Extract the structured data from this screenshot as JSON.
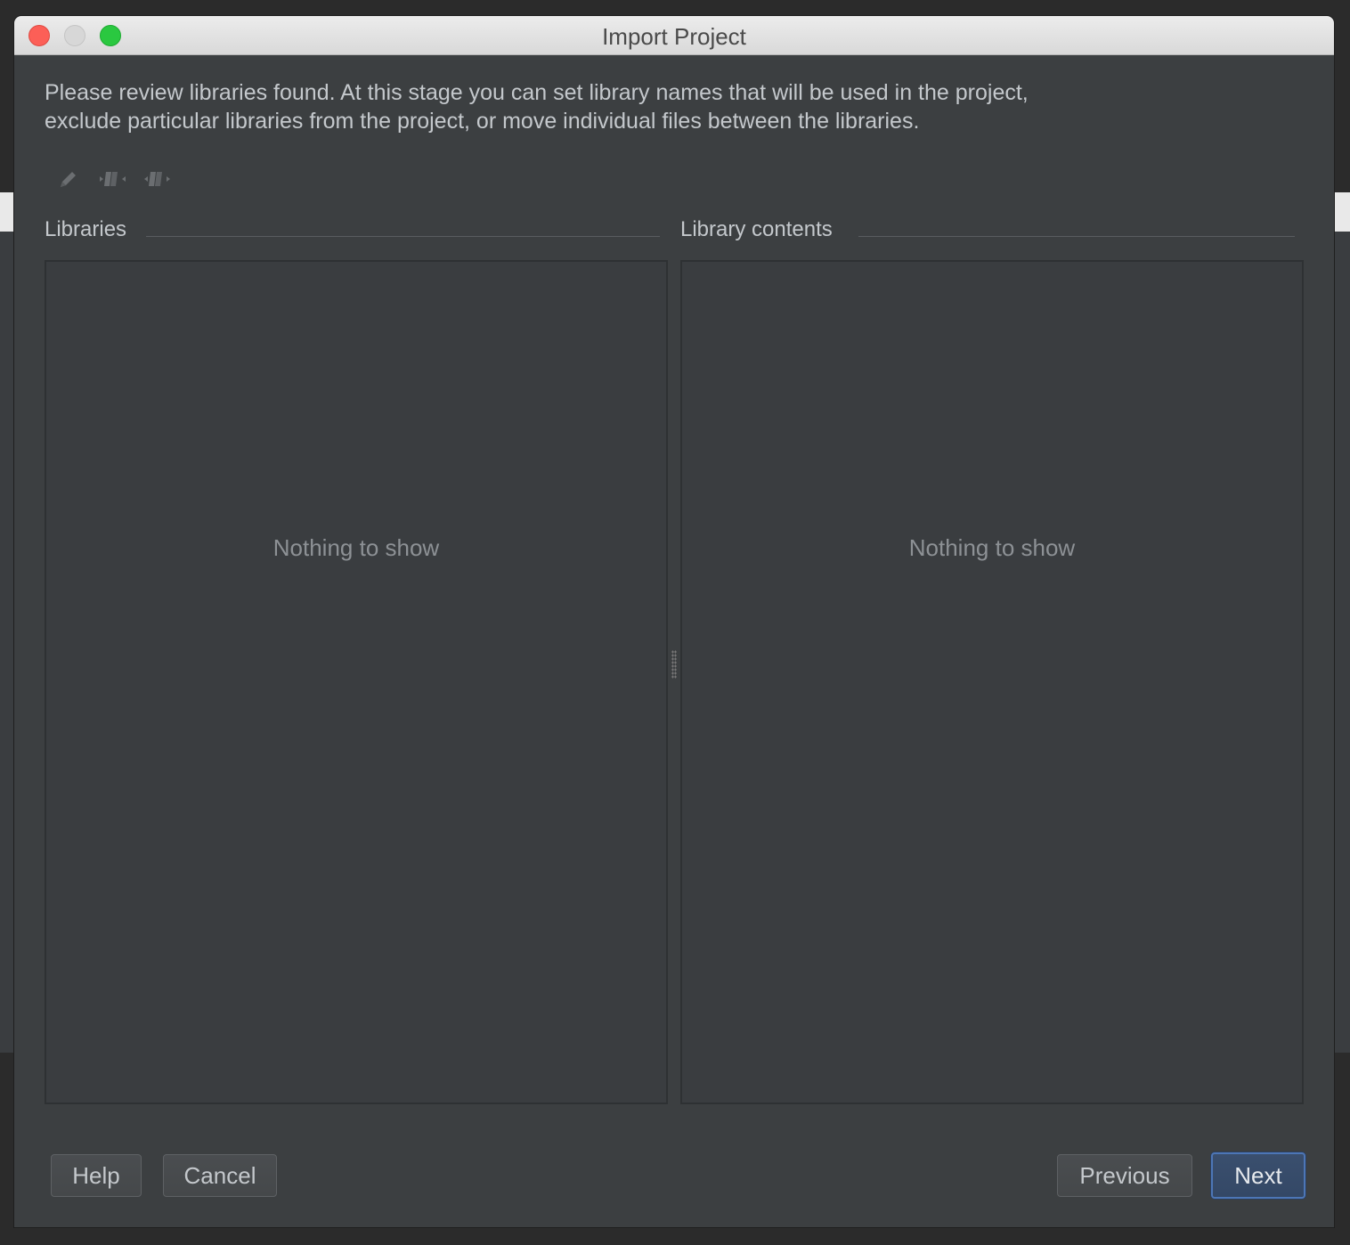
{
  "window": {
    "title": "Import Project"
  },
  "description": {
    "line1": "Please review libraries found. At this stage you can set library names that will be used in the project,",
    "line2": "exclude particular libraries from the project, or move individual files between the libraries."
  },
  "toolbar": {
    "icons": [
      "pencil-icon",
      "merge-left-icon",
      "split-right-icon"
    ]
  },
  "libraries": {
    "label": "Libraries",
    "empty_text": "Nothing to show"
  },
  "library_contents": {
    "label": "Library contents",
    "empty_text": "Nothing to show"
  },
  "buttons": {
    "help": "Help",
    "cancel": "Cancel",
    "previous": "Previous",
    "next": "Next"
  },
  "colors": {
    "background": "#3c3f41",
    "panel": "#3a3d40",
    "text": "#c4c8cc",
    "muted_text": "#8d9195",
    "primary_border": "#4d76b6"
  }
}
